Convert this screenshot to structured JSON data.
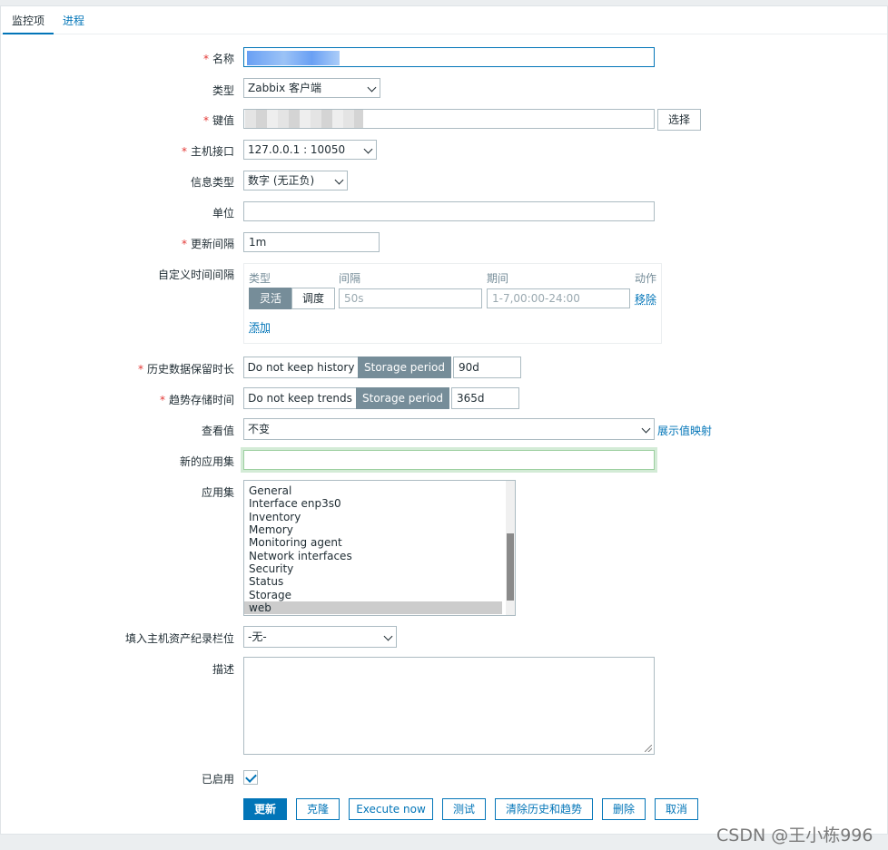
{
  "tabs": {
    "active": "监控项",
    "other": "进程"
  },
  "labels": {
    "name": "名称",
    "type": "类型",
    "key": "键值",
    "interface": "主机接口",
    "info_type": "信息类型",
    "units": "单位",
    "update_interval": "更新间隔",
    "custom_intervals": "自定义时间间隔",
    "history": "历史数据保留时长",
    "trends": "趋势存储时间",
    "show_value": "查看值",
    "new_application": "新的应用集",
    "applications": "应用集",
    "inventory_field": "填入主机资产纪录栏位",
    "description": "描述",
    "enabled": "已启用"
  },
  "required_mark": "*",
  "fields": {
    "type": "Zabbix 客户端",
    "key_select_button": "选择",
    "interface": "127.0.0.1 : 10050",
    "info_type": "数字 (无正负)",
    "units": "",
    "update_interval": "1m",
    "show_value": "不变",
    "show_value_link": "展示值映射",
    "new_application": "",
    "inventory_field": "-无-",
    "description": ""
  },
  "custom_intervals": {
    "headers": {
      "type": "类型",
      "interval": "间隔",
      "period": "期间",
      "action": "动作"
    },
    "type_flexible": "灵活",
    "type_scheduling": "调度",
    "interval_placeholder": "50s",
    "period_placeholder": "1-7,00:00-24:00",
    "remove": "移除",
    "add": "添加"
  },
  "history": {
    "no_keep": "Do not keep history",
    "storage": "Storage period",
    "value": "90d"
  },
  "trends": {
    "no_keep": "Do not keep trends",
    "storage": "Storage period",
    "value": "365d"
  },
  "applications_list": [
    "General",
    "Interface enp3s0",
    "Inventory",
    "Memory",
    "Monitoring agent",
    "Network interfaces",
    "Security",
    "Status",
    "Storage",
    "web"
  ],
  "applications_selected": "web",
  "enabled": true,
  "actions": {
    "update": "更新",
    "clone": "克隆",
    "execute_now": "Execute now",
    "test": "测试",
    "clear_history": "清除历史和趋势",
    "delete": "删除",
    "cancel": "取消"
  },
  "watermark": "CSDN @王小栋996",
  "colors": {
    "accent": "#0275b8",
    "required": "#e33734",
    "segment_active": "#768d99"
  }
}
